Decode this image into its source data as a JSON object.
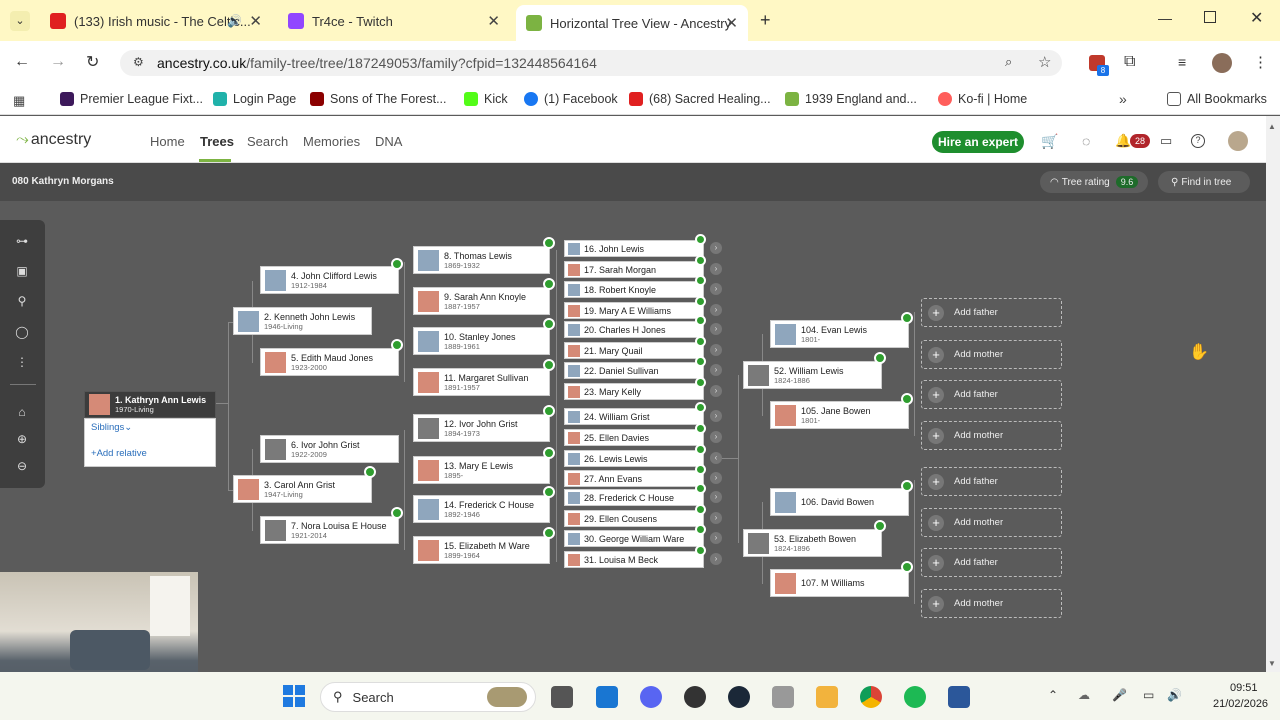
{
  "browser": {
    "tabs": [
      {
        "label": "(133) Irish music - The Celtic...",
        "color": "#e02020"
      },
      {
        "label": "Tr4ce - Twitch",
        "color": "#9146ff"
      },
      {
        "label": "Horizontal Tree View - Ancestry",
        "color": "#7cb342"
      }
    ],
    "url_host": "ancestry.co.uk",
    "url_path": "/family-tree/tree/187249053/family?cfpid=132448564164",
    "ext_badge": "8",
    "bookmarks": [
      "Premier League Fixt...",
      "Login Page",
      "Sons of The Forest...",
      "Kick",
      "(1) Facebook",
      "(68) Sacred Healing...",
      "1939 England and...",
      "Ko-fi | Home"
    ],
    "all_bookmarks": "All Bookmarks"
  },
  "ancestry": {
    "logo": "ancestry",
    "nav": [
      "Home",
      "Trees",
      "Search",
      "Memories",
      "DNA"
    ],
    "hire": "Hire an expert",
    "notif_count": "28",
    "tree_name": "080 Kathryn Morgans",
    "tree_rating_label": "Tree rating",
    "tree_rating_value": "9.6",
    "find_in_tree": "Find in tree",
    "siblings": "Siblings",
    "add_relative": "Add relative",
    "add_father": "Add father",
    "add_mother": "Add mother"
  },
  "people": {
    "p1": {
      "name": "1. Kathryn Ann Lewis",
      "years": "1970-Living"
    },
    "p2": {
      "name": "2. Kenneth John Lewis",
      "years": "1946-Living"
    },
    "p3": {
      "name": "3. Carol Ann Grist",
      "years": "1947-Living"
    },
    "p4": {
      "name": "4. John Clifford Lewis",
      "years": "1912-1984"
    },
    "p5": {
      "name": "5. Edith Maud Jones",
      "years": "1923-2000"
    },
    "p6": {
      "name": "6. Ivor John Grist",
      "years": "1922-2009"
    },
    "p7": {
      "name": "7. Nora Louisa E House",
      "years": "1921-2014"
    },
    "p8": {
      "name": "8. Thomas Lewis",
      "years": "1869-1932"
    },
    "p9": {
      "name": "9. Sarah Ann Knoyle",
      "years": "1887-1957"
    },
    "p10": {
      "name": "10. Stanley Jones",
      "years": "1889-1961"
    },
    "p11": {
      "name": "11. Margaret Sullivan",
      "years": "1891-1957"
    },
    "p12": {
      "name": "12. Ivor John Grist",
      "years": "1894-1973"
    },
    "p13": {
      "name": "13. Mary E Lewis",
      "years": "1895-"
    },
    "p14": {
      "name": "14. Frederick C House",
      "years": "1892-1946"
    },
    "p15": {
      "name": "15. Elizabeth M Ware",
      "years": "1899-1964"
    },
    "gen5": [
      "16. John Lewis",
      "17. Sarah Morgan",
      "18. Robert Knoyle",
      "19. Mary A E Williams",
      "20. Charles H Jones",
      "21. Mary Quail",
      "22. Daniel Sullivan",
      "23. Mary Kelly",
      "24. William Grist",
      "25. Ellen Davies",
      "26. Lewis Lewis",
      "27. Ann Evans",
      "28. Frederick C House",
      "29. Ellen Cousens",
      "30. George William Ware",
      "31. Louisa M Beck"
    ],
    "p52": {
      "name": "52. William Lewis",
      "years": "1824-1886"
    },
    "p53": {
      "name": "53. Elizabeth Bowen",
      "years": "1824-1896"
    },
    "p104": {
      "name": "104. Evan Lewis",
      "years": "1801-"
    },
    "p105": {
      "name": "105. Jane Bowen",
      "years": "1801-"
    },
    "p106": {
      "name": "106. David Bowen",
      "years": ""
    },
    "p107": {
      "name": "107. M Williams",
      "years": ""
    }
  },
  "taskbar": {
    "search": "Search",
    "time": "09:51",
    "date": "21/02/2026"
  }
}
